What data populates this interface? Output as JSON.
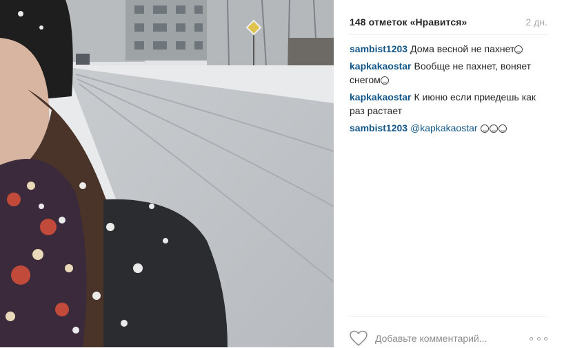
{
  "post": {
    "likes_text": "148 отметок «Нравится»",
    "time_ago": "2 дн."
  },
  "comments": [
    {
      "user": "sambist1203",
      "text": "Дома весной не пахнет",
      "emojis": 1
    },
    {
      "user": "kapkakaostar",
      "text": "Вообще не пахнет, воняет снегом",
      "emojis": 1
    },
    {
      "user": "kapkakaostar",
      "text": "К июню если приедешь как раз растает",
      "emojis": 0
    },
    {
      "user": "sambist1203",
      "mention": "@kapkakaostar",
      "text": "",
      "emojis": 3
    }
  ],
  "footer": {
    "comment_placeholder": "Добавьте комментарий...",
    "like_icon": "heart-outline-icon",
    "more_icon": "more-options-icon"
  },
  "colors": {
    "username": "#125688",
    "text": "#262626",
    "muted": "#a5a7aa"
  }
}
